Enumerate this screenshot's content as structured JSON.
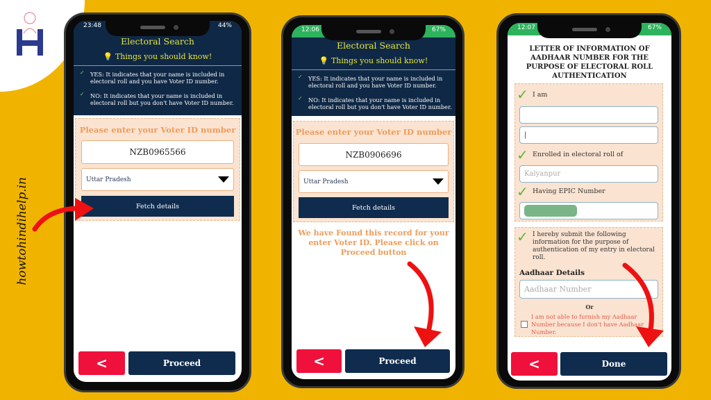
{
  "brand": {
    "site": "howtohindihelp.in",
    "logo_letter": "H"
  },
  "colors": {
    "background": "#f0b400",
    "navy": "#0f2846",
    "accent_orange": "#ee9c5a",
    "back_red": "#f0103c",
    "status_green": "#2db35c",
    "arrow_red": "#ee1111"
  },
  "phone1": {
    "time": "23:48",
    "battery": "44%",
    "title": "Electoral Search",
    "know": "Things you should know!",
    "bullets": [
      "YES: It indicates that your name is included in electoral roll and you have Voter ID number.",
      "NO: It indicates that your name is included in electoral roll but you don't have Voter ID number."
    ],
    "prompt": "Please enter your Voter ID number",
    "voter_id": "NZB0965566",
    "state": "Uttar Pradesh",
    "fetch": "Fetch details",
    "back": "<",
    "proceed": "Proceed"
  },
  "phone2": {
    "time": "12:06",
    "battery": "67%",
    "title": "Electoral Search",
    "know": "Things you should know!",
    "bullets": [
      "YES: It indicates that your name is included in electoral roll and you have Voter ID number.",
      "NO: It indicates that your name is included in electoral roll but you don't have Voter ID number."
    ],
    "prompt": "Please enter your Voter ID number",
    "voter_id": "NZB0906696",
    "state": "Uttar Pradesh",
    "fetch": "Fetch details",
    "found": "We have Found this record for your enter Voter ID. Please click on Proceed button",
    "back": "<",
    "proceed": "Proceed"
  },
  "phone3": {
    "time": "12:07",
    "battery": "67%",
    "title": "LETTER OF INFORMATION OF AADHAAR NUMBER FOR THE PURPOSE OF ELECTORAL ROLL AUTHENTICATION",
    "i_am": "I am",
    "enrolled": "Enrolled in electoral roll of",
    "constituency_placeholder": "Kalyanpur",
    "epic": "Having EPIC Number",
    "submit": "I hereby submit the following information for the purpose of authentication of my entry in electoral roll.",
    "aadhaar_heading": "Aadhaar Details",
    "aadhaar_placeholder": "Aadhaar Number",
    "or": "Or",
    "no_aadhaar": "I am not able to furnish my Aadhaar Number because I don't have Aadhaar Number.",
    "back": "<",
    "done": "Done"
  }
}
